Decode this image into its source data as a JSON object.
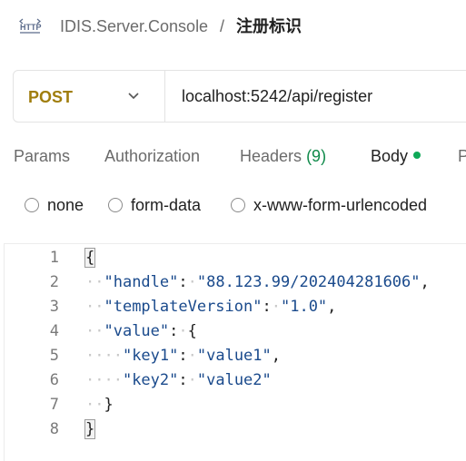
{
  "breadcrumb": {
    "icon_text": "HTTP",
    "parent": "IDIS.Server.Console",
    "separator": "/",
    "current": "注册标识"
  },
  "request": {
    "method": "POST",
    "url": "localhost:5242/api/register"
  },
  "tabs": [
    {
      "label": "Params"
    },
    {
      "label": "Authorization"
    },
    {
      "label": "Headers",
      "count": "(9)"
    },
    {
      "label": "Body",
      "active": true
    },
    {
      "label": "P"
    }
  ],
  "body_type": {
    "options": [
      "none",
      "form-data",
      "x-www-form-urlencoded"
    ],
    "selected": ""
  },
  "editor": {
    "line_numbers": [
      "1",
      "2",
      "3",
      "4",
      "5",
      "6",
      "7",
      "8"
    ],
    "lines": [
      "{",
      "  \"handle\": \"88.123.99/202404281606\",",
      "  \"templateVersion\": \"1.0\",",
      "  \"value\": {",
      "    \"key1\": \"value1\",",
      "    \"key2\": \"value2\"",
      "  }",
      "}"
    ],
    "tokens": {
      "handle_key": "\"handle\"",
      "handle_val": "\"88.123.99/202404281606\"",
      "tv_key": "\"templateVersion\"",
      "tv_val": "\"1.0\"",
      "value_key": "\"value\"",
      "key1": "\"key1\"",
      "val1": "\"value1\"",
      "key2": "\"key2\"",
      "val2": "\"value2\"",
      "open_brace": "{",
      "close_brace": "}",
      "colon": ":",
      "comma": ","
    }
  },
  "colors": {
    "method": "#a07e0d",
    "headers_count": "#0f8a4a",
    "active_dot": "#0fa958",
    "json_string": "#1a4a8c"
  }
}
